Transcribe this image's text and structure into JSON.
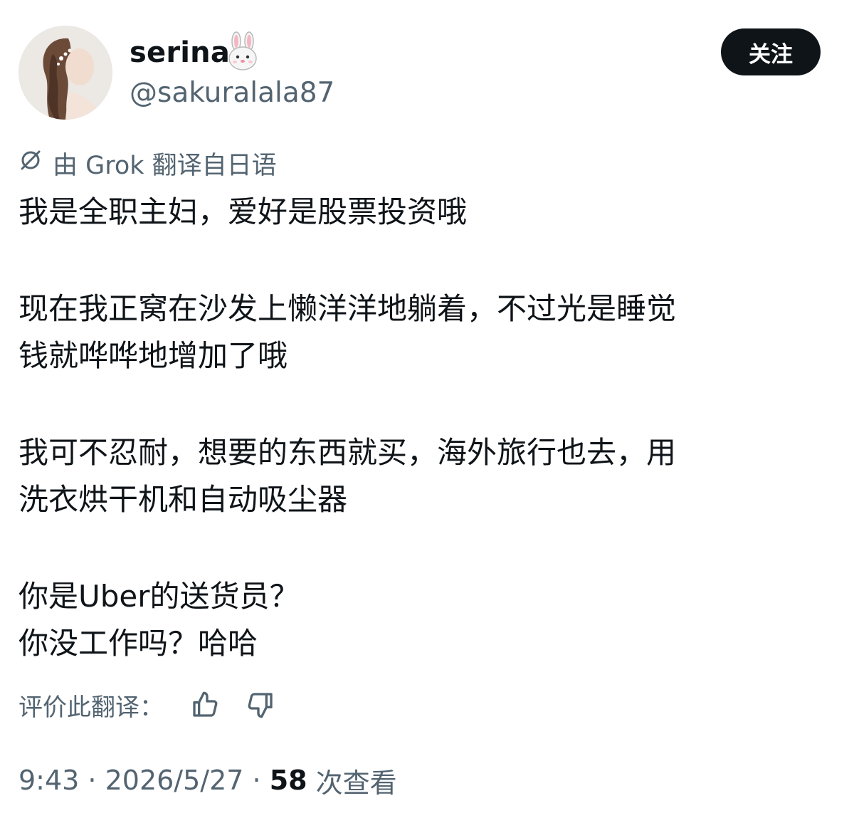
{
  "user": {
    "display_name": "serina",
    "name_emoji": "rabbit-face",
    "handle": "@sakuralala87"
  },
  "follow_label": "关注",
  "translation": {
    "note": "由 Grok 翻译自日语",
    "icon": "translate-icon"
  },
  "tweet": {
    "p1": "我是全职主妇，爱好是股票投资哦",
    "p2_l1": "现在我正窝在沙发上懒洋洋地躺着，不过光是睡觉",
    "p2_l2": "钱就哗哗地增加了哦",
    "p3_l1": "我可不忍耐，想要的东西就买，海外旅行也去，用",
    "p3_l2": "洗衣烘干机和自动吸尘器",
    "p4_l1": "你是Uber的送货员？",
    "p4_l2": "你没工作吗？哈哈"
  },
  "rating": {
    "label": "评价此翻译：",
    "up_icon": "thumbs-up-icon",
    "down_icon": "thumbs-down-icon"
  },
  "meta": {
    "time": "9:43",
    "sep": " · ",
    "date": "2026/5/27",
    "views": "58",
    "views_label": " 次查看"
  },
  "colors": {
    "text": "#0f1419",
    "secondary": "#536471",
    "button_bg": "#0f1419"
  }
}
